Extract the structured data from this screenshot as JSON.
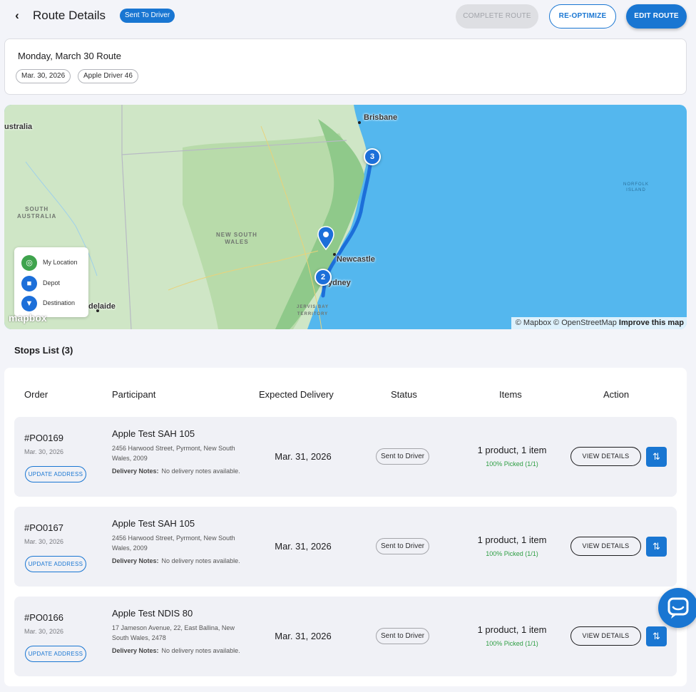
{
  "header": {
    "back_icon": "chevron-left-icon",
    "title": "Route Details",
    "status": "Sent To Driver",
    "complete_label": "COMPLETE ROUTE",
    "reoptimize_label": "RE-OPTIMIZE",
    "edit_label": "EDIT ROUTE"
  },
  "route": {
    "name": "Monday, March 30 Route",
    "date_chip": "Mar. 30, 2026",
    "driver_chip": "Apple Driver 46"
  },
  "map": {
    "labels": {
      "australia": "ustralia",
      "south_australia": "SOUTH\nAUSTRALIA",
      "nsw": "NEW SOUTH\nWALES",
      "brisbane": "Brisbane",
      "newcastle": "Newcastle",
      "sydney": "ydney",
      "adelaide": "delaide",
      "jervis": "JERVIS BAY\nTERRITORY",
      "norfolk": "NORFOLK\nISLAND"
    },
    "markers": [
      "3",
      "2"
    ],
    "legend": [
      {
        "label": "My Location",
        "icon": "crosshair-icon",
        "color": "#3fa34d"
      },
      {
        "label": "Depot",
        "icon": "truck-icon",
        "color": "#1c6fd9"
      },
      {
        "label": "Destination",
        "icon": "pin-icon",
        "color": "#1c6fd9"
      }
    ],
    "logo": "mapbox",
    "attribution_1": "© Mapbox © OpenStreetMap",
    "attribution_2": "Improve this map"
  },
  "stops": {
    "title": "Stops List (3)",
    "columns": [
      "Order",
      "Participant",
      "Expected Delivery",
      "Status",
      "Items",
      "Action"
    ],
    "update_label": "UPDATE ADDRESS",
    "view_label": "VIEW DETAILS",
    "notes_label": "Delivery Notes:",
    "rows": [
      {
        "order": "#PO0169",
        "order_date": "Mar. 30, 2026",
        "participant": "Apple Test SAH 105",
        "address": "2456 Harwood Street, Pyrmont, New South Wales, 2009",
        "notes": "No delivery notes available.",
        "expected": "Mar. 31, 2026",
        "status": "Sent to Driver",
        "items": "1 product, 1 item",
        "picked": "100% Picked (1/1)"
      },
      {
        "order": "#PO0167",
        "order_date": "Mar. 30, 2026",
        "participant": "Apple Test SAH 105",
        "address": "2456 Harwood Street, Pyrmont, New South Wales, 2009",
        "notes": "No delivery notes available.",
        "expected": "Mar. 31, 2026",
        "status": "Sent to Driver",
        "items": "1 product, 1 item",
        "picked": "100% Picked (1/1)"
      },
      {
        "order": "#PO0166",
        "order_date": "Mar. 30, 2026",
        "participant": "Apple Test NDIS 80",
        "address": "17 Jameson Avenue, 22, East Ballina, New South Wales, 2478",
        "notes": "No delivery notes available.",
        "expected": "Mar. 31, 2026",
        "status": "Sent to Driver",
        "items": "1 product, 1 item",
        "picked": "100% Picked (1/1)"
      }
    ]
  },
  "chat_icon": "chat-bubble-icon"
}
